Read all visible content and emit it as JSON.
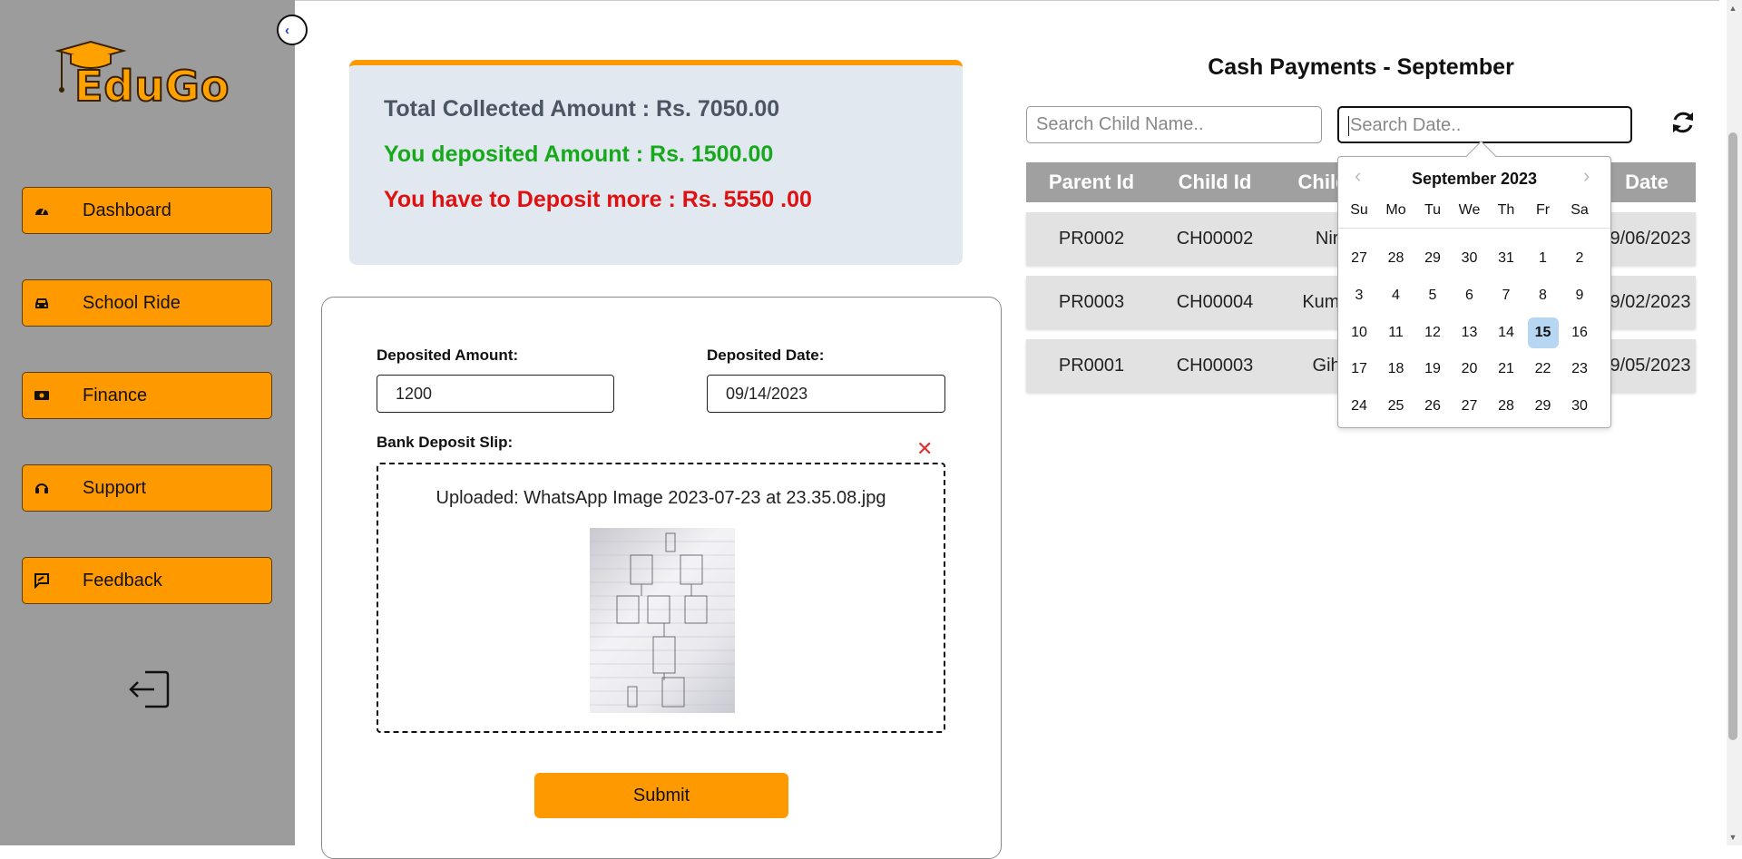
{
  "brand": {
    "name": "EduGo"
  },
  "sidebar": {
    "collapse_symbol": "‹",
    "items": [
      {
        "label": "Dashboard",
        "icon": "speedometer-icon"
      },
      {
        "label": "School Ride",
        "icon": "car-icon"
      },
      {
        "label": "Finance",
        "icon": "money-icon"
      },
      {
        "label": "Support",
        "icon": "headset-icon"
      },
      {
        "label": "Feedback",
        "icon": "chat-edit-icon"
      }
    ],
    "logout_icon": "logout-icon"
  },
  "summary": {
    "total": "Total Collected Amount : Rs. 7050.00",
    "deposited": "You deposited Amount : Rs. 1500.00",
    "remaining": "You have to Deposit more : Rs. 5550 .00",
    "colors": {
      "total": "#4b5563",
      "deposited": "#17a81b",
      "remaining": "#e11010"
    }
  },
  "form": {
    "amount_label": "Deposited Amount:",
    "amount_value": "1200",
    "date_label": "Deposited Date:",
    "date_value": "09/14/2023",
    "slip_label": "Bank Deposit Slip:",
    "uploaded_text": "Uploaded: WhatsApp Image 2023-07-23 at 23.35.08.jpg",
    "remove_symbol": "✕",
    "submit_label": "Submit"
  },
  "payments": {
    "title": "Cash Payments - September",
    "search_child_placeholder": "Search Child Name..",
    "search_date_placeholder": "Search Date..",
    "columns": [
      "Parent Id",
      "Child Id",
      "Child",
      "Date"
    ],
    "rows": [
      {
        "parent_id": "PR0002",
        "child_id": "CH00002",
        "child": "Nirm",
        "date": "9/06/2023"
      },
      {
        "parent_id": "PR0003",
        "child_id": "CH00004",
        "child": "Kumud",
        "date": "9/02/2023"
      },
      {
        "parent_id": "PR0001",
        "child_id": "CH00003",
        "child": "Gihar",
        "date": "9/05/2023"
      }
    ]
  },
  "calendar": {
    "month_label": "September 2023",
    "prev": "‹",
    "next": "›",
    "weekdays": [
      "Su",
      "Mo",
      "Tu",
      "We",
      "Th",
      "Fr",
      "Sa"
    ],
    "weeks": [
      [
        "27",
        "28",
        "29",
        "30",
        "31",
        "1",
        "2"
      ],
      [
        "3",
        "4",
        "5",
        "6",
        "7",
        "8",
        "9"
      ],
      [
        "10",
        "11",
        "12",
        "13",
        "14",
        "15",
        "16"
      ],
      [
        "17",
        "18",
        "19",
        "20",
        "21",
        "22",
        "23"
      ],
      [
        "24",
        "25",
        "26",
        "27",
        "28",
        "29",
        "30"
      ]
    ],
    "selected": "15"
  },
  "colors": {
    "accent": "#ff9900",
    "sidebar_bg": "#9c9c9c",
    "summary_bg": "#e2e8f0",
    "table_header": "#a0a0a0"
  }
}
